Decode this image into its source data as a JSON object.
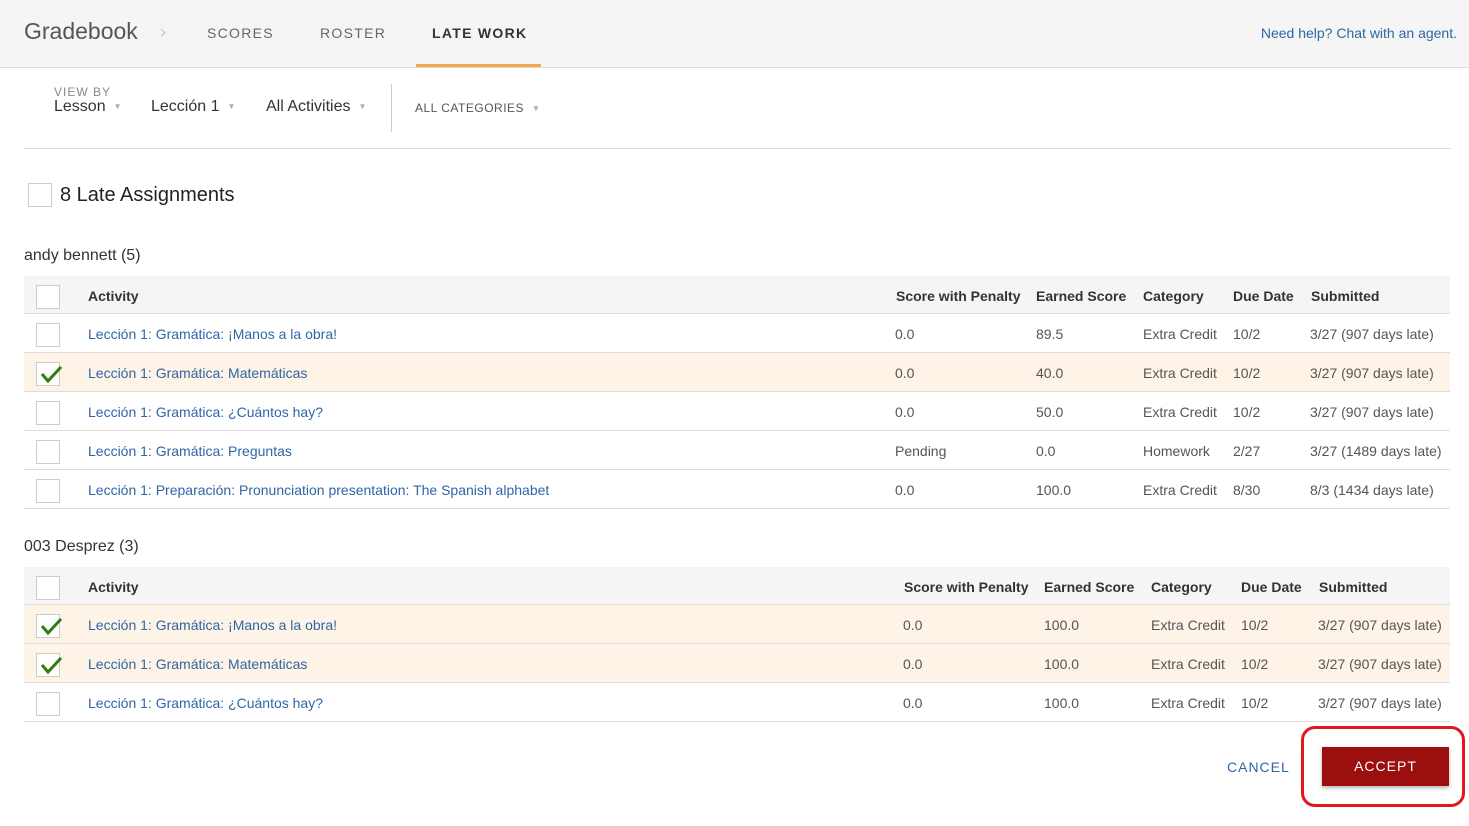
{
  "header": {
    "app_title": "Gradebook",
    "tabs": [
      {
        "label": "SCORES"
      },
      {
        "label": "ROSTER"
      },
      {
        "label": "LATE WORK"
      }
    ],
    "help_link": "Need help? Chat with an agent."
  },
  "filters": {
    "view_by_label": "VIEW BY",
    "view_by_value": "Lesson",
    "lesson": "Lección 1",
    "activities": "All Activities",
    "categories": "ALL CATEGORIES"
  },
  "late": {
    "title": "8 Late Assignments"
  },
  "columns": {
    "activity": "Activity",
    "score_penalty": "Score with Penalty",
    "earned": "Earned Score",
    "category": "Category",
    "due": "Due Date",
    "submitted": "Submitted"
  },
  "groups": [
    {
      "name": "andy bennett (5)",
      "rows": [
        {
          "checked": false,
          "activity": "Lección 1: Gramática: ¡Manos a la obra!",
          "score_penalty": "0.0",
          "earned": "89.5",
          "category": "Extra Credit",
          "due": "10/2",
          "submitted": "3/27 (907 days late)"
        },
        {
          "checked": true,
          "activity": "Lección 1: Gramática: Matemáticas",
          "score_penalty": "0.0",
          "earned": "40.0",
          "category": "Extra Credit",
          "due": "10/2",
          "submitted": "3/27 (907 days late)"
        },
        {
          "checked": false,
          "activity": "Lección 1: Gramática: ¿Cuántos hay?",
          "score_penalty": "0.0",
          "earned": "50.0",
          "category": "Extra Credit",
          "due": "10/2",
          "submitted": "3/27 (907 days late)"
        },
        {
          "checked": false,
          "activity": "Lección 1: Gramática: Preguntas",
          "score_penalty": "Pending",
          "earned": "0.0",
          "category": "Homework",
          "due": "2/27",
          "submitted": "3/27 (1489 days late)"
        },
        {
          "checked": false,
          "activity": "Lección 1: Preparación: Pronunciation presentation: The Spanish alphabet",
          "score_penalty": "0.0",
          "earned": "100.0",
          "category": "Extra Credit",
          "due": "8/30",
          "submitted": "8/3 (1434 days late)"
        }
      ]
    },
    {
      "name": "003 Desprez (3)",
      "rows": [
        {
          "checked": true,
          "activity": "Lección 1: Gramática: ¡Manos a la obra!",
          "score_penalty": "0.0",
          "earned": "100.0",
          "category": "Extra Credit",
          "due": "10/2",
          "submitted": "3/27 (907 days late)"
        },
        {
          "checked": true,
          "activity": "Lección 1: Gramática: Matemáticas",
          "score_penalty": "0.0",
          "earned": "100.0",
          "category": "Extra Credit",
          "due": "10/2",
          "submitted": "3/27 (907 days late)"
        },
        {
          "checked": false,
          "activity": "Lección 1: Gramática: ¿Cuántos hay?",
          "score_penalty": "0.0",
          "earned": "100.0",
          "category": "Extra Credit",
          "due": "10/2",
          "submitted": "3/27 (907 days late)"
        }
      ]
    }
  ],
  "actions": {
    "cancel": "CANCEL",
    "accept": "ACCEPT"
  }
}
